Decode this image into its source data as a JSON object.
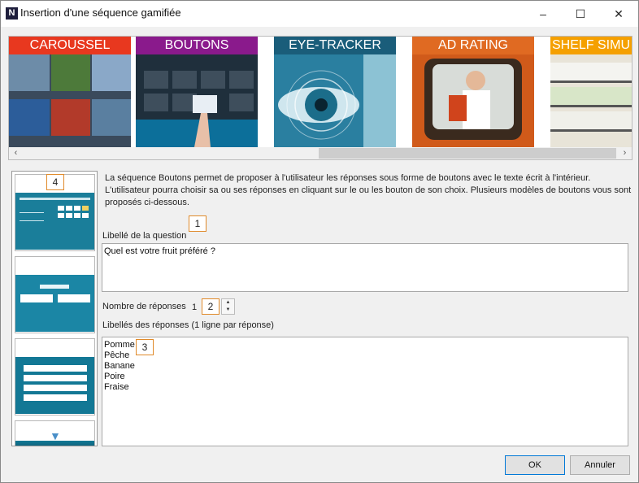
{
  "window": {
    "title": "Insertion d'une séquence gamifiée",
    "app_icon_letter": "N",
    "controls": {
      "minimize": "–",
      "maximize": "☐",
      "close": "✕"
    }
  },
  "gallery": {
    "tiles": [
      {
        "label": "CAROUSSEL",
        "band_color": "#e8381f"
      },
      {
        "label": "BOUTONS",
        "band_color": "#8a1a8c"
      },
      {
        "label": "EYE-TRACKER",
        "band_color": "#1a5d7a"
      },
      {
        "label": "AD RATING",
        "band_color": "#e06a22"
      },
      {
        "label": "SHELF SIMU",
        "band_color": "#f5a000"
      }
    ],
    "scroll_left": "‹",
    "scroll_right": "›"
  },
  "thumbnails": {
    "scroll_down": "▼"
  },
  "description": "La séquence Boutons permet de proposer à l'utilisateur les réponses sous forme de boutons avec le texte écrit à l'intérieur. L'utilisateur pourra choisir sa ou ses réponses en cliquant sur le ou les bouton de son choix. Plusieurs modèles de boutons vous sont proposés ci-dessous.",
  "question": {
    "label": "Libellé de la question",
    "value": "Quel est votre fruit préféré ?"
  },
  "responses_count": {
    "label": "Nombre de réponses",
    "value": "1",
    "up": "▲",
    "down": "▼"
  },
  "responses": {
    "label": "Libellés des réponses (1 ligne par réponse)",
    "lines": [
      "Pomme",
      "Pêche",
      "Banane",
      "Poire",
      "Fraise"
    ]
  },
  "callouts": {
    "c1": "1",
    "c2": "2",
    "c3": "3",
    "c4": "4"
  },
  "buttons": {
    "ok": "OK",
    "cancel": "Annuler"
  }
}
